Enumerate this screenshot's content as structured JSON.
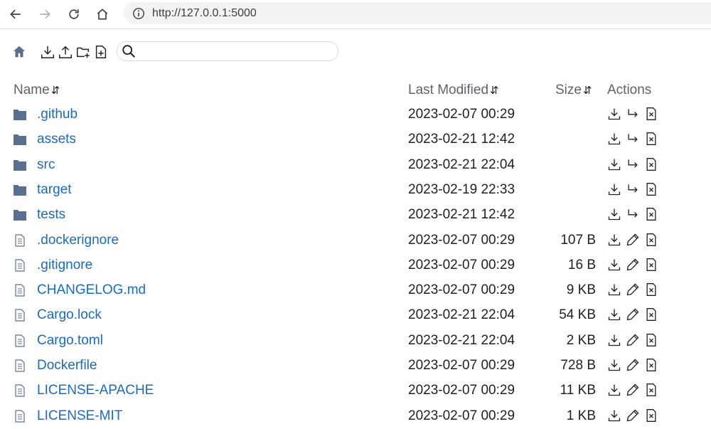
{
  "browser": {
    "url": "http://127.0.0.1:5000"
  },
  "search": {
    "value": "",
    "placeholder": ""
  },
  "table": {
    "headers": {
      "name": "Name",
      "modified": "Last Modified",
      "size": "Size",
      "actions": "Actions"
    },
    "sort_glyph": "⇵",
    "rows": [
      {
        "type": "folder",
        "name": ".github",
        "modified": "2023-02-07 00:29",
        "size": ""
      },
      {
        "type": "folder",
        "name": "assets",
        "modified": "2023-02-21 12:42",
        "size": ""
      },
      {
        "type": "folder",
        "name": "src",
        "modified": "2023-02-21 22:04",
        "size": ""
      },
      {
        "type": "folder",
        "name": "target",
        "modified": "2023-02-19 22:33",
        "size": ""
      },
      {
        "type": "folder",
        "name": "tests",
        "modified": "2023-02-21 12:42",
        "size": ""
      },
      {
        "type": "file",
        "name": ".dockerignore",
        "modified": "2023-02-07 00:29",
        "size": "107 B"
      },
      {
        "type": "file",
        "name": ".gitignore",
        "modified": "2023-02-07 00:29",
        "size": "16 B"
      },
      {
        "type": "file",
        "name": "CHANGELOG.md",
        "modified": "2023-02-07 00:29",
        "size": "9 KB"
      },
      {
        "type": "file",
        "name": "Cargo.lock",
        "modified": "2023-02-21 22:04",
        "size": "54 KB"
      },
      {
        "type": "file",
        "name": "Cargo.toml",
        "modified": "2023-02-21 22:04",
        "size": "2 KB"
      },
      {
        "type": "file",
        "name": "Dockerfile",
        "modified": "2023-02-07 00:29",
        "size": "728 B"
      },
      {
        "type": "file",
        "name": "LICENSE-APACHE",
        "modified": "2023-02-07 00:29",
        "size": "11 KB"
      },
      {
        "type": "file",
        "name": "LICENSE-MIT",
        "modified": "2023-02-07 00:29",
        "size": "1 KB"
      }
    ]
  },
  "colors": {
    "link": "#1a6bbf",
    "folder": "#5a6f8f",
    "home": "#5a6f8f"
  }
}
